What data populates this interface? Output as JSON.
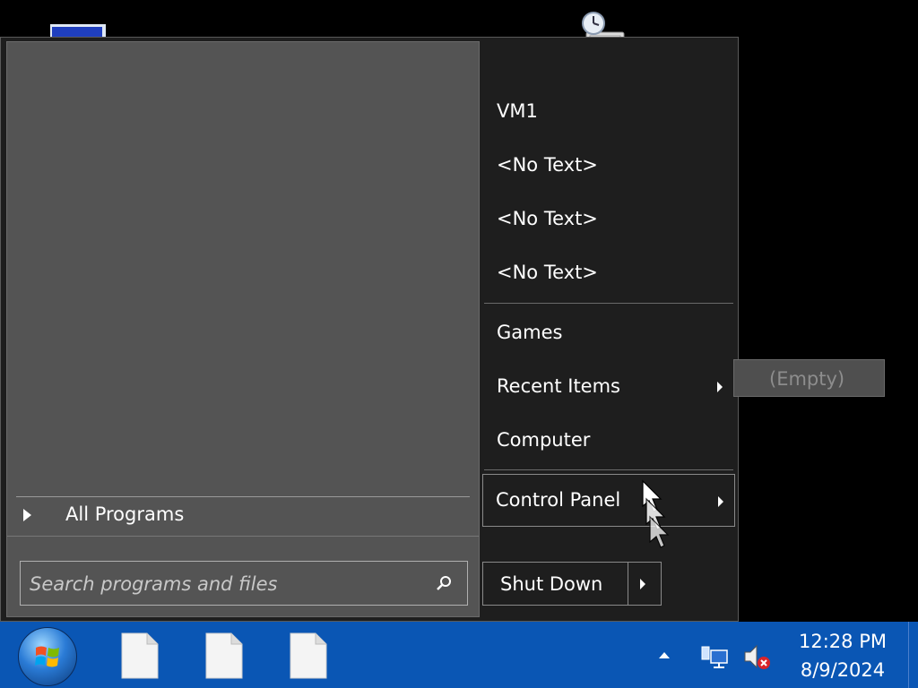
{
  "start_menu": {
    "right_items": [
      {
        "label": "VM1"
      },
      {
        "label": "<No Text>"
      },
      {
        "label": "<No Text>"
      },
      {
        "label": "<No Text>"
      },
      {
        "label": "Games"
      },
      {
        "label": "Recent Items"
      },
      {
        "label": "Computer"
      }
    ],
    "control_panel": {
      "label": "Control Panel"
    },
    "all_programs": {
      "label": "All Programs"
    },
    "search": {
      "placeholder": "Search programs and files",
      "value": ""
    },
    "shutdown": {
      "label": "Shut Down"
    },
    "recent_items_submenu": {
      "label": "(Empty)"
    }
  },
  "taskbar": {
    "clock": {
      "time": "12:28 PM",
      "date": "8/9/2024"
    },
    "pinned": [
      "file-icon",
      "file-icon",
      "file-icon"
    ],
    "tray_icons": [
      "show-hidden-icons-arrow",
      "network-icon",
      "volume-muted-icon"
    ]
  },
  "colors": {
    "menu_bg": "#1e1e1e",
    "left_pane_bg": "#545454",
    "taskbar_bg": "#0a56b4",
    "submenu_bg": "#4f4f4f"
  }
}
